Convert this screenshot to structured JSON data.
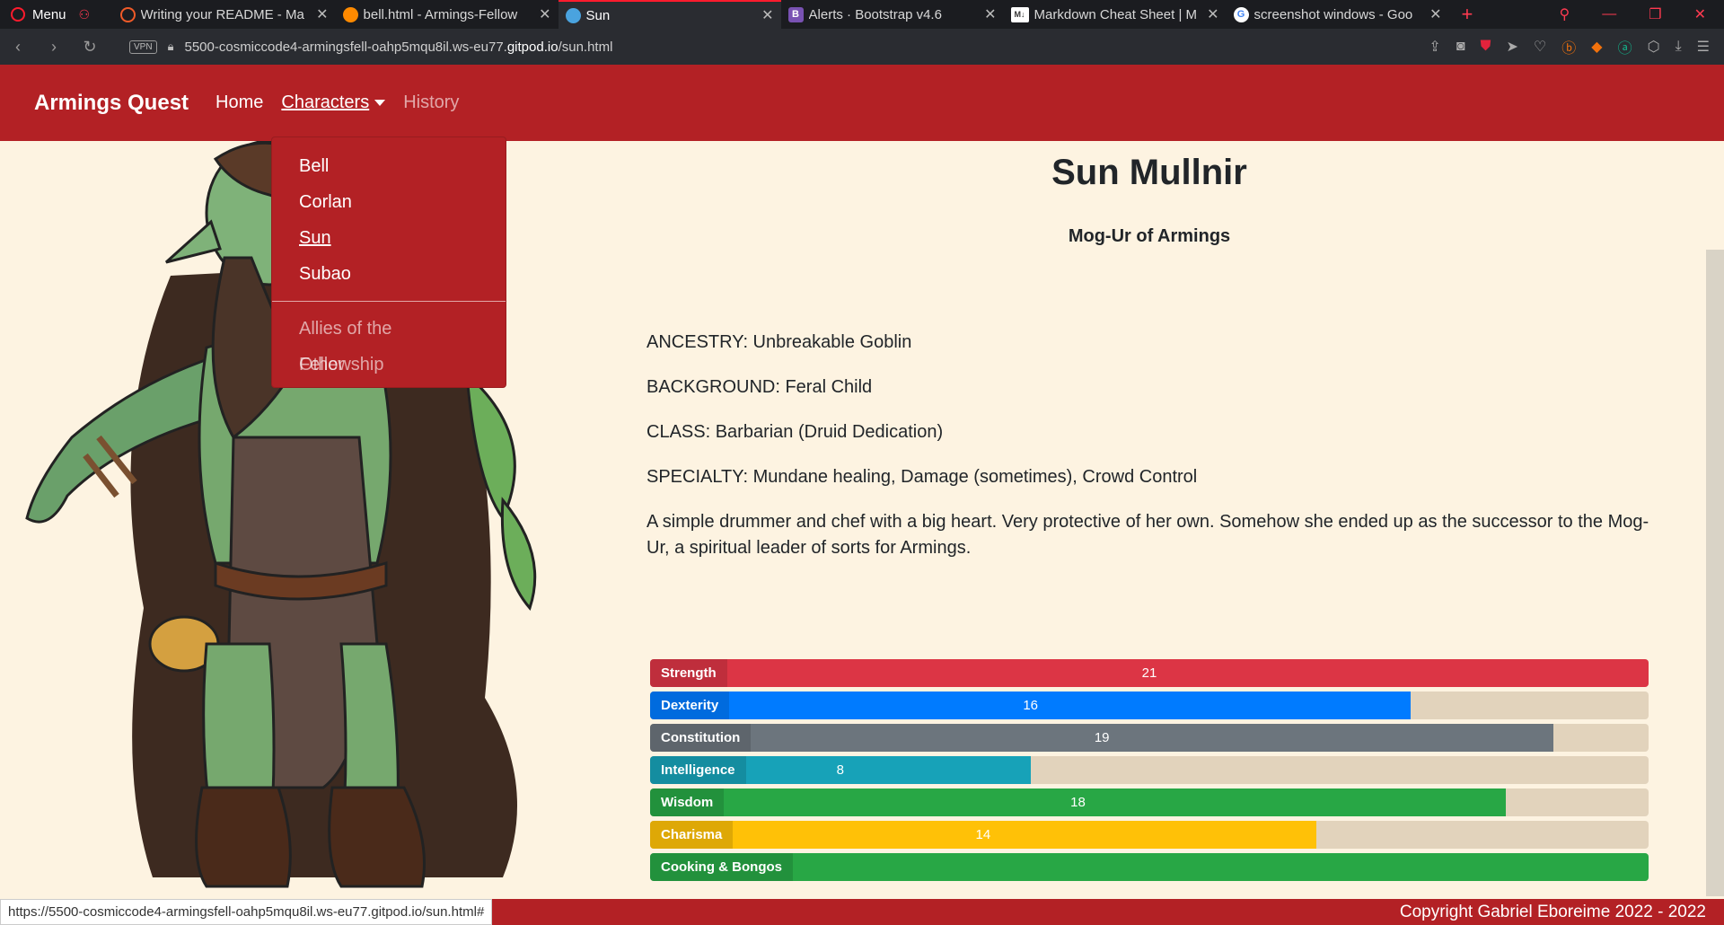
{
  "browser": {
    "menu_label": "Menu",
    "tabs": [
      {
        "title": "Writing your README - Ma",
        "fav_color": "#f05a28"
      },
      {
        "title": "bell.html - Armings-Fellow",
        "fav_color": "#ff8a00"
      },
      {
        "title": "Sun",
        "fav_color": "#4aa3df"
      },
      {
        "title": "Alerts · Bootstrap v4.6",
        "fav_color": "#7952b3",
        "fav_text": "B"
      },
      {
        "title": "Markdown Cheat Sheet | M",
        "fav_color": "#333",
        "fav_text": "M↓"
      },
      {
        "title": "screenshot windows - Goo",
        "fav_color": "#4285f4",
        "fav_text": "G"
      }
    ],
    "vpn_label": "VPN",
    "url_pre": "5500-cosmiccode4-armingsfell-oahp5mqu8il.ws-eu77.",
    "url_host": "gitpod.io",
    "url_path": "/sun.html",
    "status_url": "https://5500-cosmiccode4-armingsfell-oahp5mqu8il.ws-eu77.gitpod.io/sun.html#"
  },
  "navbar": {
    "brand": "Armings Quest",
    "home": "Home",
    "characters": "Characters",
    "history": "History"
  },
  "dropdown": {
    "items": [
      "Bell",
      "Corlan",
      "Sun",
      "Subao"
    ],
    "extra": [
      "Allies of the Fellowship",
      "Other"
    ]
  },
  "character": {
    "name": "Sun Mullnir",
    "subtitle": "Mog-Ur of Armings",
    "ancestry": "ANCESTRY: Unbreakable Goblin",
    "background": "BACKGROUND: Feral Child",
    "class": "CLASS: Barbarian (Druid Dedication)",
    "specialty": "SPECIALTY: Mundane healing, Damage (sometimes), Crowd Control",
    "description": "A simple drummer and chef with a big heart. Very protective of her own. Somehow she ended up as the successor to the Mog-Ur, a spiritual leader of sorts for Armings."
  },
  "stats": [
    {
      "label": "Strength",
      "value": "21",
      "fraction": 1.0,
      "color": "#dc3545"
    },
    {
      "label": "Dexterity",
      "value": "16",
      "fraction": 0.762,
      "color": "#007bff"
    },
    {
      "label": "Constitution",
      "value": "19",
      "fraction": 0.905,
      "color": "#6c757d"
    },
    {
      "label": "Intelligence",
      "value": "8",
      "fraction": 0.381,
      "color": "#17a2b8"
    },
    {
      "label": "Wisdom",
      "value": "18",
      "fraction": 0.857,
      "color": "#28a745"
    },
    {
      "label": "Charisma",
      "value": "14",
      "fraction": 0.667,
      "color": "#ffc107"
    },
    {
      "label": "Cooking & Bongos",
      "value": "",
      "fraction": 1.0,
      "color": "#28a745"
    }
  ],
  "footer": {
    "copyright": "Copyright Gabriel Eboreime 2022 - 2022"
  }
}
